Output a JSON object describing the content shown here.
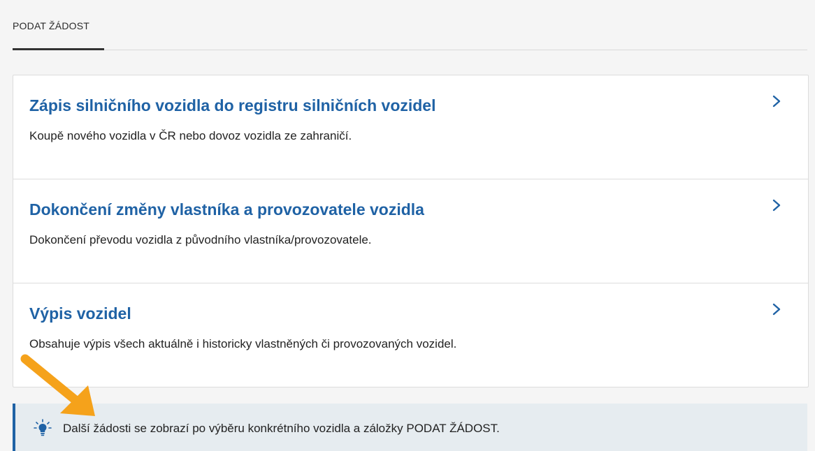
{
  "tabs": [
    {
      "label": "PODAT ŽÁDOST",
      "active": true
    }
  ],
  "cards": [
    {
      "title": "Zápis silničního vozidla do registru silničních vozidel",
      "description": "Koupě nového vozidla v ČR nebo dovoz vozidla ze zahraničí."
    },
    {
      "title": "Dokončení změny vlastníka a provozovatele vozidla",
      "description": "Dokončení převodu vozidla z původního vlastníka/provozovatele."
    },
    {
      "title": "Výpis vozidel",
      "description": "Obsahuje výpis všech aktuálně i historicky vlastněných či provozovaných vozidel."
    }
  ],
  "info": {
    "text": "Další žádosti se zobrazí po výběru konkrétního vozidla a záložky PODAT ŽÁDOST.",
    "icon": "lightbulb-icon"
  },
  "colors": {
    "accent": "#1f62a5",
    "info_background": "#e6ecf0",
    "annotation_arrow": "#f5a21b"
  }
}
